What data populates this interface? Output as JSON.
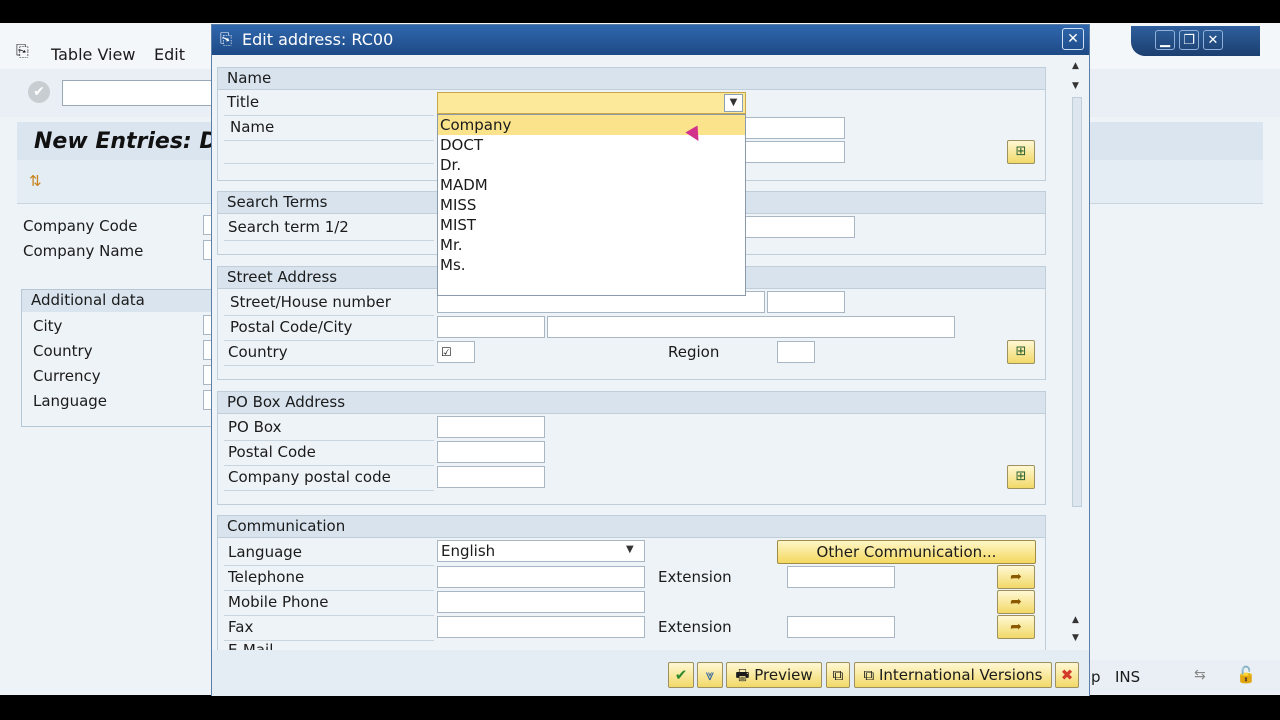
{
  "background": {
    "menu": [
      "Table View",
      "Edit"
    ],
    "screen_title": "New Entries: De",
    "fields": [
      "Company Code",
      "Company Name"
    ],
    "group_title": "Additional data",
    "group_fields": [
      "City",
      "Country",
      "Currency",
      "Language"
    ],
    "status": {
      "mode": "INS",
      "trailing": "p"
    }
  },
  "dialog": {
    "title": "Edit address:  RC00",
    "name_group": {
      "title": "Name",
      "title_label": "Title",
      "name_label": "Name",
      "title_options": [
        "Company",
        "DOCT",
        "Dr.",
        "MADM",
        "MISS",
        "MIST",
        "Mr.",
        "Ms."
      ],
      "highlighted_option": "Company"
    },
    "search_group": {
      "title": "Search Terms",
      "label": "Search term 1/2"
    },
    "street_group": {
      "title": "Street Address",
      "street_label": "Street/House number",
      "postal_label": "Postal Code/City",
      "country_label": "Country",
      "region_label": "Region"
    },
    "pobox_group": {
      "title": "PO Box Address",
      "pobox_label": "PO Box",
      "postal_label": "Postal Code",
      "company_postal_label": "Company postal code"
    },
    "comm_group": {
      "title": "Communication",
      "language_label": "Language",
      "language_value": "English",
      "other_comm_label": "Other Communication...",
      "telephone_label": "Telephone",
      "extension_label": "Extension",
      "mobile_label": "Mobile Phone",
      "fax_label": "Fax",
      "fax_extension_label": "Extension",
      "email_label": "E-Mail"
    },
    "footer": {
      "preview_label": "Preview",
      "intl_label": "International Versions"
    }
  }
}
